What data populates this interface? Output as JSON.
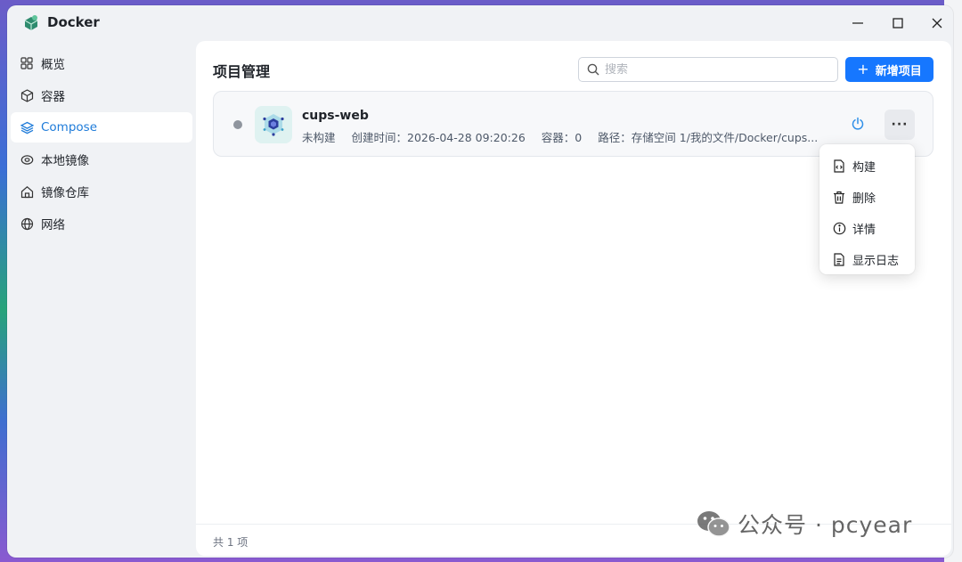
{
  "app": {
    "title": "Docker"
  },
  "window_controls": {
    "minimize": "minimize",
    "maximize": "maximize",
    "close": "close"
  },
  "sidebar": {
    "items": [
      {
        "label": "概览",
        "icon": "grid-icon",
        "active": false
      },
      {
        "label": "容器",
        "icon": "cube-icon",
        "active": false
      },
      {
        "label": "Compose",
        "icon": "layers-icon",
        "active": true
      },
      {
        "label": "本地镜像",
        "icon": "eye-disc-icon",
        "active": false
      },
      {
        "label": "镜像仓库",
        "icon": "home-icon",
        "active": false
      },
      {
        "label": "网络",
        "icon": "globe-icon",
        "active": false
      }
    ]
  },
  "main": {
    "title": "项目管理",
    "search": {
      "placeholder": "搜索",
      "value": ""
    },
    "add_button": {
      "label": "新增项目"
    },
    "projects": [
      {
        "name": "cups-web",
        "status": "未构建",
        "created": "创建时间：2026-04-28 09:20:26",
        "containers": "容器：0",
        "path": "路径：存储空间 1/我的文件/Docker/cups..."
      }
    ],
    "context_menu": [
      {
        "label": "构建",
        "icon": "build-file-icon"
      },
      {
        "label": "删除",
        "icon": "trash-icon"
      },
      {
        "label": "详情",
        "icon": "info-icon"
      },
      {
        "label": "显示日志",
        "icon": "log-file-icon"
      }
    ],
    "footer": "共 1 项"
  },
  "watermark": {
    "text": "公众号 · pcyear"
  },
  "colors": {
    "accent": "#1677ff",
    "active_text": "#1e7bd9",
    "status_gray": "#8f959e"
  }
}
